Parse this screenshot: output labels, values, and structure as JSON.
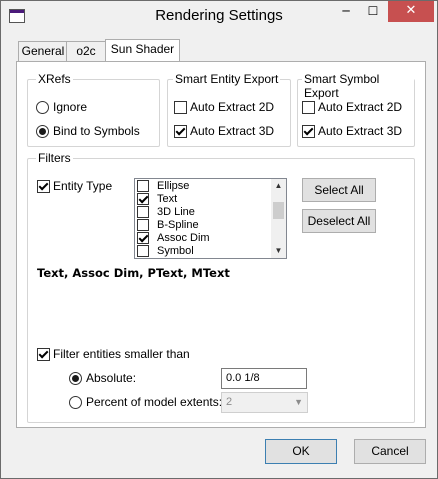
{
  "window": {
    "title": "Rendering Settings",
    "min_glyph": "─",
    "max_glyph": "☐",
    "close_glyph": "✕"
  },
  "tabs": [
    {
      "label": "General"
    },
    {
      "label": "o2c"
    },
    {
      "label": "Sun Shader"
    }
  ],
  "xrefs": {
    "legend": "XRefs",
    "options": [
      {
        "label": "Ignore",
        "checked": false
      },
      {
        "label": "Bind to Symbols",
        "checked": true
      }
    ]
  },
  "smart_entity": {
    "legend": "Smart Entity Export",
    "auto2d": {
      "label": "Auto Extract 2D",
      "checked": false
    },
    "auto3d": {
      "label": "Auto Extract 3D",
      "checked": true
    }
  },
  "smart_symbol": {
    "legend": "Smart Symbol Export",
    "auto2d": {
      "label": "Auto Extract 2D",
      "checked": false
    },
    "auto3d": {
      "label": "Auto Extract 3D",
      "checked": true
    }
  },
  "filters": {
    "legend": "Filters",
    "entity_type": {
      "label": "Entity Type",
      "checked": true
    },
    "list": [
      {
        "label": "Ellipse",
        "checked": false
      },
      {
        "label": "Text",
        "checked": true
      },
      {
        "label": "3D Line",
        "checked": false
      },
      {
        "label": "B-Spline",
        "checked": false
      },
      {
        "label": "Assoc Dim",
        "checked": true
      },
      {
        "label": "Symbol",
        "checked": false
      }
    ],
    "select_all": "Select All",
    "deselect_all": "Deselect All",
    "summary": "Text, Assoc Dim, PText, MText",
    "smaller": {
      "label": "Filter entities smaller than",
      "checked": true
    },
    "absolute": {
      "label": "Absolute:",
      "checked": true,
      "value": "0.0 1/8"
    },
    "percent": {
      "label": "Percent of model extents:",
      "checked": false,
      "value": "2"
    }
  },
  "footer": {
    "ok": "OK",
    "cancel": "Cancel"
  }
}
